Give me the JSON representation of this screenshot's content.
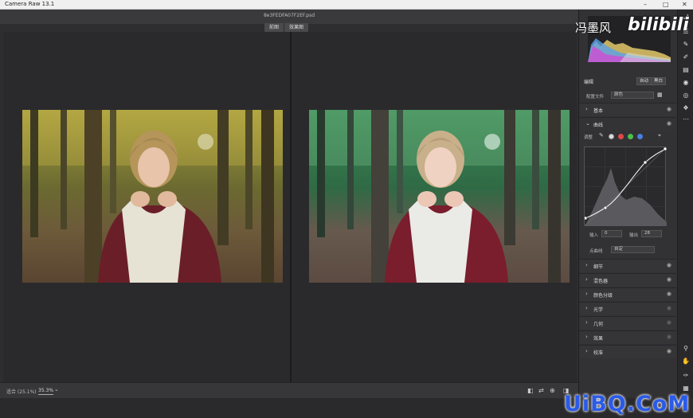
{
  "window": {
    "title": "Camera Raw 13.1",
    "controls": [
      "–",
      "□",
      "✕"
    ]
  },
  "file": {
    "name": "8e3FEDFA07F2EF.psd"
  },
  "view_tabs": [
    "前图",
    "效果图"
  ],
  "bottom": {
    "zoom_label": "适合 (25.1%)",
    "zoom_value": "35.3%",
    "zoom_caret": "⌄",
    "icons": [
      "compare-icon",
      "swap-icon",
      "copy-settings-icon",
      "toggle-icon"
    ]
  },
  "panel": {
    "edit": {
      "title": "编辑",
      "auto_label": "自动",
      "bw_label": "黑白",
      "profile_label": "配置文件",
      "profile_value": "颜色"
    },
    "sections_top": [
      {
        "label": "基本",
        "expanded": false
      }
    ],
    "curve": {
      "label": "曲线",
      "adjust_label": "调整",
      "input_label": "输入",
      "input_value": "0",
      "output_label": "输出",
      "output_value": "28",
      "point_label": "点曲线",
      "point_value": "自定",
      "channel_colors": [
        "#dddddd",
        "#e04848",
        "#4cbf4c",
        "#4a7de0"
      ]
    },
    "sections_bottom": [
      {
        "label": "细节",
        "dim": false
      },
      {
        "label": "混色器",
        "dim": false
      },
      {
        "label": "颜色分级",
        "dim": false
      },
      {
        "label": "光学",
        "dim": true
      },
      {
        "label": "几何",
        "dim": true
      },
      {
        "label": "效果",
        "dim": true
      },
      {
        "label": "校准",
        "dim": false
      }
    ]
  },
  "tools": [
    "zoom-icon",
    "hand-icon",
    "eyedropper-icon",
    "grid-icon"
  ],
  "watermarks": {
    "author": "冯墨风",
    "site": "bilibili",
    "corner": "UiBQ.CoM"
  }
}
